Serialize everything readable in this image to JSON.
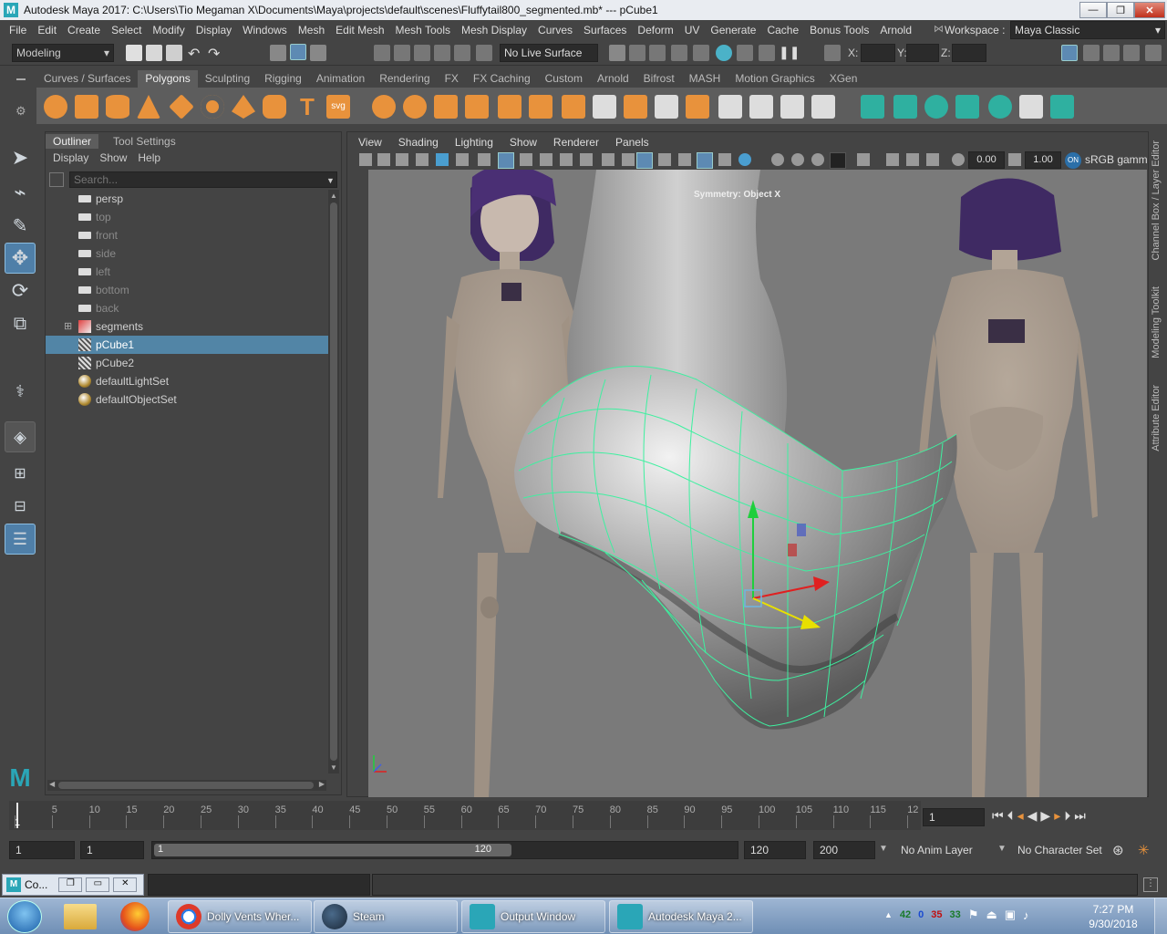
{
  "window": {
    "title": "Autodesk Maya 2017: C:\\Users\\Tio Megaman X\\Documents\\Maya\\projects\\default\\scenes\\Fluffytail800_segmented.mb*   ---   pCube1",
    "logo": "M",
    "minimize_glyph": "—",
    "restore_glyph": "❐",
    "close_glyph": "✕"
  },
  "menubar": {
    "items": [
      "File",
      "Edit",
      "Create",
      "Select",
      "Modify",
      "Display",
      "Windows",
      "Mesh",
      "Edit Mesh",
      "Mesh Tools",
      "Mesh Display",
      "Curves",
      "Surfaces",
      "Deform",
      "UV",
      "Generate",
      "Cache",
      "Bonus Tools",
      "Arnold"
    ],
    "workspace_label": "Workspace :",
    "workspace_value": "Maya Classic"
  },
  "statusline": {
    "menuset": "Modeling",
    "live_surface": "No Live Surface",
    "x_label": "X:",
    "y_label": "Y:",
    "z_label": "Z:"
  },
  "shelf": {
    "tabs": [
      "Curves / Surfaces",
      "Polygons",
      "Sculpting",
      "Rigging",
      "Animation",
      "Rendering",
      "FX",
      "FX Caching",
      "Custom",
      "Arnold",
      "Bifrost",
      "MASH",
      "Motion Graphics",
      "XGen"
    ],
    "active_tab": "Polygons",
    "text_icon": "T",
    "svg_icon": "svg"
  },
  "outliner": {
    "tabs": [
      "Outliner",
      "Tool Settings"
    ],
    "menus": [
      "Display",
      "Show",
      "Help"
    ],
    "search_placeholder": "Search...",
    "items": [
      {
        "label": "persp",
        "icon": "camera-icon",
        "dim": false
      },
      {
        "label": "top",
        "icon": "camera-icon",
        "dim": true
      },
      {
        "label": "front",
        "icon": "camera-icon",
        "dim": true
      },
      {
        "label": "side",
        "icon": "camera-icon",
        "dim": true
      },
      {
        "label": "left",
        "icon": "camera-icon",
        "dim": true
      },
      {
        "label": "bottom",
        "icon": "camera-icon",
        "dim": true
      },
      {
        "label": "back",
        "icon": "camera-icon",
        "dim": true
      },
      {
        "label": "segments",
        "icon": "group-icon",
        "dim": false
      },
      {
        "label": "pCube1",
        "icon": "mesh-icon",
        "dim": false,
        "selected": true
      },
      {
        "label": "pCube2",
        "icon": "mesh-icon",
        "dim": false
      },
      {
        "label": "defaultLightSet",
        "icon": "set-icon",
        "dim": false
      },
      {
        "label": "defaultObjectSet",
        "icon": "set-icon",
        "dim": false
      }
    ]
  },
  "viewport": {
    "menus": [
      "View",
      "Shading",
      "Lighting",
      "Show",
      "Renderer",
      "Panels"
    ],
    "exposure": "0.00",
    "gamma": "1.00",
    "color_space": "sRGB gamma",
    "symmetry_label": "Symmetry: Object X",
    "side_tabs": [
      "Channel Box / Layer Editor",
      "Modeling Toolkit",
      "Attribute Editor"
    ]
  },
  "timeline": {
    "ticks": [
      "1",
      "5",
      "10",
      "15",
      "20",
      "25",
      "30",
      "35",
      "40",
      "45",
      "50",
      "55",
      "60",
      "65",
      "70",
      "75",
      "80",
      "85",
      "90",
      "95",
      "100",
      "105",
      "110",
      "115",
      "12"
    ],
    "current_frame": "1"
  },
  "range": {
    "start": "1",
    "playback_start": "1",
    "slider_start": "1",
    "slider_end": "120",
    "playback_end": "120",
    "end": "200",
    "anim_layer": "No Anim Layer",
    "character_set": "No Character Set"
  },
  "cmdline": {
    "label": "Co..."
  },
  "taskbar": {
    "items": [
      {
        "label": "Dolly Vents Wher...",
        "icon": "chrome-icon"
      },
      {
        "label": "Steam",
        "icon": "steam-icon"
      },
      {
        "label": "Output Window",
        "icon": "maya-icon"
      },
      {
        "label": "Autodesk Maya 2...",
        "icon": "maya-icon"
      }
    ],
    "tray_numbers": [
      "42",
      "0",
      "35",
      "33"
    ],
    "time": "7:27 PM",
    "date": "9/30/2018"
  },
  "colors": {
    "accent_blue": "#4f7fa8",
    "wire_green": "#3ef0a0",
    "shelf_orange": "#e8923c",
    "shelf_teal": "#2fb0a0"
  }
}
